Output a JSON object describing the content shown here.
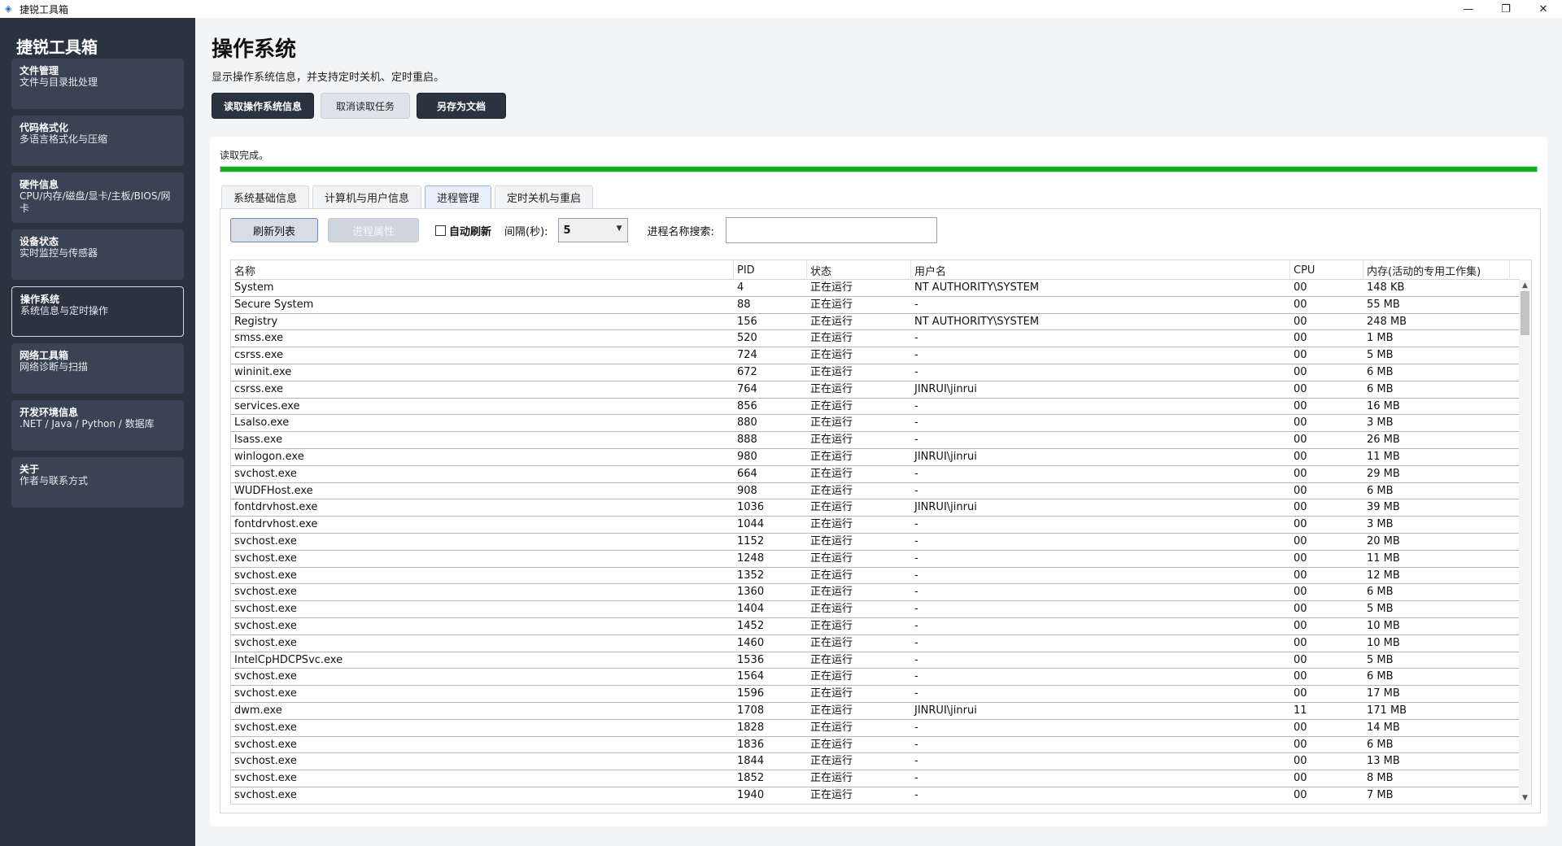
{
  "window": {
    "title": "捷锐工具箱",
    "minimize": "—",
    "maximize": "❐",
    "close": "✕"
  },
  "sidebar": {
    "brand": "捷锐工具箱",
    "items": [
      {
        "title": "文件管理",
        "subtitle": "文件与目录批处理"
      },
      {
        "title": "代码格式化",
        "subtitle": "多语言格式化与压缩"
      },
      {
        "title": "硬件信息",
        "subtitle": "CPU/内存/磁盘/显卡/主板/BIOS/网卡"
      },
      {
        "title": "设备状态",
        "subtitle": "实时监控与传感器"
      },
      {
        "title": "操作系统",
        "subtitle": "系统信息与定时操作",
        "active": true
      },
      {
        "title": "网络工具箱",
        "subtitle": "网络诊断与扫描"
      },
      {
        "title": "开发环境信息",
        "subtitle": ".NET / Java / Python / 数据库"
      },
      {
        "title": "关于",
        "subtitle": "作者与联系方式"
      }
    ]
  },
  "header": {
    "title": "操作系统",
    "description": "显示操作系统信息，并支持定时关机、定时重启。"
  },
  "toolbar": {
    "read_label": "读取操作系统信息",
    "cancel_label": "取消读取任务",
    "save_label": "另存为文档"
  },
  "status": {
    "text": "读取完成。",
    "progress": 1.0
  },
  "tabs": [
    {
      "label": "系统基础信息"
    },
    {
      "label": "计算机与用户信息"
    },
    {
      "label": "进程管理",
      "active": true
    },
    {
      "label": "定时关机与重启"
    }
  ],
  "process_toolbar": {
    "refresh_label": "刷新列表",
    "props_label": "进程属性",
    "auto_refresh_label": "自动刷新",
    "auto_refresh_checked": false,
    "interval_label": "间隔(秒):",
    "interval_value": "5",
    "search_label": "进程名称搜索:",
    "search_value": ""
  },
  "table": {
    "columns": [
      "名称",
      "PID",
      "状态",
      "用户名",
      "CPU",
      "内存(活动的专用工作集)"
    ],
    "rows": [
      [
        "System",
        "4",
        "正在运行",
        "NT AUTHORITY\\SYSTEM",
        "00",
        "148 KB"
      ],
      [
        "Secure System",
        "88",
        "正在运行",
        "-",
        "00",
        "55 MB"
      ],
      [
        "Registry",
        "156",
        "正在运行",
        "NT AUTHORITY\\SYSTEM",
        "00",
        "248 MB"
      ],
      [
        "smss.exe",
        "520",
        "正在运行",
        "-",
        "00",
        "1 MB"
      ],
      [
        "csrss.exe",
        "724",
        "正在运行",
        "-",
        "00",
        "5 MB"
      ],
      [
        "wininit.exe",
        "672",
        "正在运行",
        "-",
        "00",
        "6 MB"
      ],
      [
        "csrss.exe",
        "764",
        "正在运行",
        "JINRUI\\jinrui",
        "00",
        "6 MB"
      ],
      [
        "services.exe",
        "856",
        "正在运行",
        "-",
        "00",
        "16 MB"
      ],
      [
        "Lsalso.exe",
        "880",
        "正在运行",
        "-",
        "00",
        "3 MB"
      ],
      [
        "lsass.exe",
        "888",
        "正在运行",
        "-",
        "00",
        "26 MB"
      ],
      [
        "winlogon.exe",
        "980",
        "正在运行",
        "JINRUI\\jinrui",
        "00",
        "11 MB"
      ],
      [
        "svchost.exe",
        "664",
        "正在运行",
        "-",
        "00",
        "29 MB"
      ],
      [
        "WUDFHost.exe",
        "908",
        "正在运行",
        "-",
        "00",
        "6 MB"
      ],
      [
        "fontdrvhost.exe",
        "1036",
        "正在运行",
        "JINRUI\\jinrui",
        "00",
        "39 MB"
      ],
      [
        "fontdrvhost.exe",
        "1044",
        "正在运行",
        "-",
        "00",
        "3 MB"
      ],
      [
        "svchost.exe",
        "1152",
        "正在运行",
        "-",
        "00",
        "20 MB"
      ],
      [
        "svchost.exe",
        "1248",
        "正在运行",
        "-",
        "00",
        "11 MB"
      ],
      [
        "svchost.exe",
        "1352",
        "正在运行",
        "-",
        "00",
        "12 MB"
      ],
      [
        "svchost.exe",
        "1360",
        "正在运行",
        "-",
        "00",
        "6 MB"
      ],
      [
        "svchost.exe",
        "1404",
        "正在运行",
        "-",
        "00",
        "5 MB"
      ],
      [
        "svchost.exe",
        "1452",
        "正在运行",
        "-",
        "00",
        "10 MB"
      ],
      [
        "svchost.exe",
        "1460",
        "正在运行",
        "-",
        "00",
        "10 MB"
      ],
      [
        "IntelCpHDCPSvc.exe",
        "1536",
        "正在运行",
        "-",
        "00",
        "5 MB"
      ],
      [
        "svchost.exe",
        "1564",
        "正在运行",
        "-",
        "00",
        "6 MB"
      ],
      [
        "svchost.exe",
        "1596",
        "正在运行",
        "-",
        "00",
        "17 MB"
      ],
      [
        "dwm.exe",
        "1708",
        "正在运行",
        "JINRUI\\jinrui",
        "11",
        "171 MB"
      ],
      [
        "svchost.exe",
        "1828",
        "正在运行",
        "-",
        "00",
        "14 MB"
      ],
      [
        "svchost.exe",
        "1836",
        "正在运行",
        "-",
        "00",
        "6 MB"
      ],
      [
        "svchost.exe",
        "1844",
        "正在运行",
        "-",
        "00",
        "13 MB"
      ],
      [
        "svchost.exe",
        "1852",
        "正在运行",
        "-",
        "00",
        "8 MB"
      ],
      [
        "svchost.exe",
        "1940",
        "正在运行",
        "-",
        "00",
        "7 MB"
      ]
    ]
  },
  "colors": {
    "sidebar_bg": "#2b3341",
    "nav_item_bg": "#3a4354",
    "progress_fill": "#06b025",
    "panel_bg": "#ffffff"
  }
}
